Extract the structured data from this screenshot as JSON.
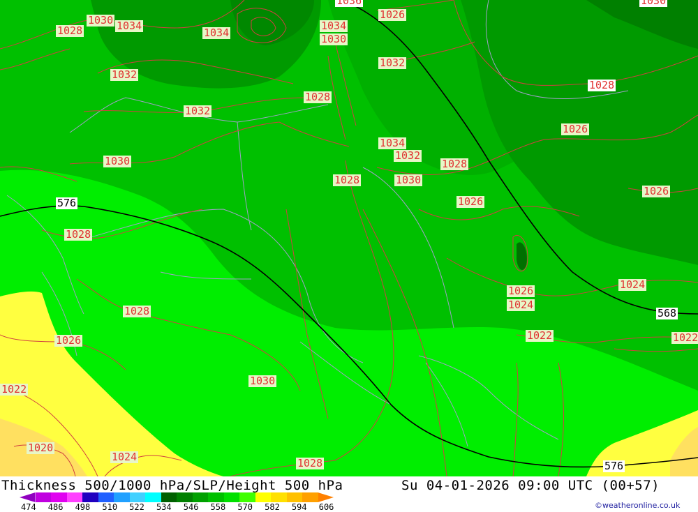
{
  "map": {
    "contour_labels": [
      "1028",
      "1030",
      "1034",
      "1034",
      "1034",
      "1036",
      "1030",
      "1026",
      "1030",
      "1032",
      "1028",
      "1032",
      "1032",
      "1034",
      "1032",
      "1028",
      "1026",
      "1030",
      "1028",
      "1030",
      "1028",
      "1026",
      "1026",
      "576",
      "1028",
      "1026",
      "1024",
      "1024",
      "1028",
      "1022",
      "1026",
      "1030",
      "1022",
      "1022",
      "1020",
      "1024",
      "1028",
      "568",
      "576"
    ],
    "colors": {
      "land_dark": "#00a000",
      "land_mid": "#00c000",
      "land_bright": "#00ee00",
      "yellow": "#ffff40",
      "orange": "#ffd000",
      "isobar": "#d04040",
      "isohypse": "#000000",
      "border": "#a0a0c0"
    }
  },
  "footer": {
    "title": "Thickness 500/1000 hPa/SLP/Height 500 hPa",
    "time": "Su 04-01-2026 09:00 UTC (00+57)",
    "scale_ticks": [
      "474",
      "486",
      "498",
      "510",
      "522",
      "534",
      "546",
      "558",
      "570",
      "582",
      "594",
      "606"
    ],
    "scale_colors": [
      "#9000c0",
      "#c000e0",
      "#e000f0",
      "#ff40ff",
      "#2000c0",
      "#2060ff",
      "#20a0ff",
      "#40d0ff",
      "#00ffff",
      "#006000",
      "#008000",
      "#00a000",
      "#00c000",
      "#00e000",
      "#40ff00",
      "#ffff00",
      "#ffe000",
      "#ffc000",
      "#ffa000",
      "#ff8000"
    ],
    "credit": "©weatheronline.co.uk"
  }
}
